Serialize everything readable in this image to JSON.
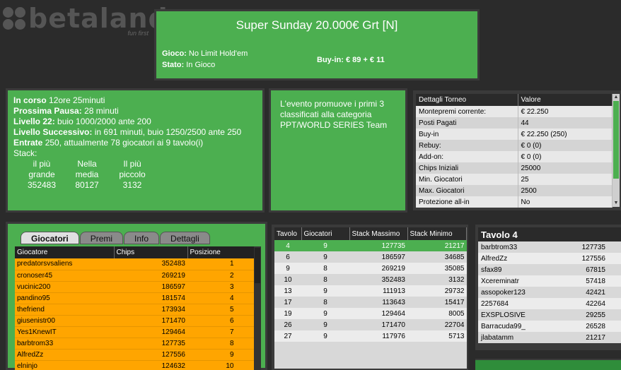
{
  "logo": {
    "name": "betaland",
    "tagline": "fun first"
  },
  "header": {
    "title": "Super Sunday 20.000€ Grt   [N]",
    "gioco_label": "Gioco:",
    "gioco_value": "No Limit Hold'em",
    "stato_label": "Stato:",
    "stato_value": "In Gioco",
    "buyin_label": "Buy-in:",
    "buyin_value": "€ 89 + € 11"
  },
  "status": {
    "in_corso_label": "In corso",
    "in_corso_value": "12ore 25minuti",
    "pausa_label": "Prossima Pausa:",
    "pausa_value": "28 minuti",
    "livello_label": "Livello 22:",
    "livello_value": "buio 1000/2000 ante 200",
    "successivo_label": "Livello Successivo:",
    "successivo_value": "in 691 minuti, buio 1250/2500 ante 250",
    "entrate_label": "Entrate",
    "entrate_value": "250, attualmente 78 giocatori ai 9 tavolo(i)",
    "stack_label": "Stack:",
    "stack_cols": [
      {
        "l1": "il più",
        "l2": "grande",
        "v": "352483"
      },
      {
        "l1": "Nella",
        "l2": "media",
        "v": "80127"
      },
      {
        "l1": "Il più",
        "l2": "piccolo",
        "v": "3132"
      }
    ]
  },
  "promo": {
    "text": "L'evento promuove i primi 3 classificati alla categoria PPT/WORLD SERIES Team"
  },
  "details": {
    "headers": [
      "Dettagli Torneo",
      "Valore"
    ],
    "rows": [
      [
        "Montepremi corrente:",
        "€ 22.250"
      ],
      [
        "Posti Pagati",
        "44"
      ],
      [
        "Buy-in",
        "€ 22.250 (250)"
      ],
      [
        "Rebuy:",
        "€ 0 (0)"
      ],
      [
        "Add-on:",
        "€ 0 (0)"
      ],
      [
        "Chips Iniziali",
        "25000"
      ],
      [
        "Min. Giocatori",
        "25"
      ],
      [
        "Max. Giocatori",
        "2500"
      ],
      [
        "Protezione all-in",
        "No"
      ]
    ]
  },
  "tabs": [
    "Giocatori",
    "Premi",
    "Info",
    "Dettagli"
  ],
  "players": {
    "headers": [
      "Giocatore",
      "Chips",
      "Posizione"
    ],
    "rows": [
      [
        "predatorsvsaliens",
        "352483",
        "1"
      ],
      [
        "cronoser45",
        "269219",
        "2"
      ],
      [
        "vucinic200",
        "186597",
        "3"
      ],
      [
        "pandino95",
        "181574",
        "4"
      ],
      [
        "thefriend",
        "173934",
        "5"
      ],
      [
        "giusenistr00",
        "171470",
        "6"
      ],
      [
        "Yes1KnewIT",
        "129464",
        "7"
      ],
      [
        "barbtrom33",
        "127735",
        "8"
      ],
      [
        "AlfredZz",
        "127556",
        "9"
      ],
      [
        "elninjo",
        "124632",
        "10"
      ]
    ]
  },
  "tables": {
    "headers": [
      "Tavolo",
      "Giocatori",
      "Stack Massimo",
      "Stack Minimo"
    ],
    "rows": [
      [
        "4",
        "9",
        "127735",
        "21217"
      ],
      [
        "6",
        "9",
        "186597",
        "34685"
      ],
      [
        "9",
        "8",
        "269219",
        "35085"
      ],
      [
        "10",
        "8",
        "352483",
        "3132"
      ],
      [
        "13",
        "9",
        "111913",
        "29732"
      ],
      [
        "17",
        "8",
        "113643",
        "15417"
      ],
      [
        "19",
        "9",
        "129464",
        "8005"
      ],
      [
        "26",
        "9",
        "171470",
        "22704"
      ],
      [
        "27",
        "9",
        "117976",
        "5713"
      ]
    ]
  },
  "tavolo": {
    "title": "Tavolo 4",
    "rows": [
      [
        "barbtrom33",
        "127735"
      ],
      [
        "AlfredZz",
        "127556"
      ],
      [
        "sfax89",
        "67815"
      ],
      [
        "Xcereminatr",
        "57418"
      ],
      [
        "assopoker123",
        "42421"
      ],
      [
        "2257684",
        "42264"
      ],
      [
        "EXSPLOSIVE",
        "29255"
      ],
      [
        "Barracuda99_",
        "26528"
      ],
      [
        "jlabatamm",
        "21217"
      ]
    ]
  },
  "colors": {
    "green": "#4caf50",
    "orange": "#ffa500",
    "dark": "#2b2b2b"
  }
}
